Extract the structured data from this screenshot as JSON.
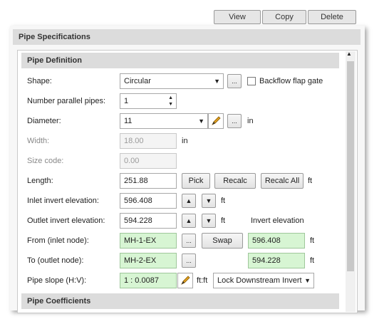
{
  "tabs": {
    "view": "View",
    "copy": "Copy",
    "delete": "Delete"
  },
  "panel_title": "Pipe Specifications",
  "section_definition": "Pipe Definition",
  "section_coefficients": "Pipe Coefficients",
  "labels": {
    "shape": "Shape:",
    "parallel": "Number parallel pipes:",
    "diameter": "Diameter:",
    "width": "Width:",
    "size_code": "Size code:",
    "length": "Length:",
    "inlet_inv": "Inlet invert elevation:",
    "outlet_inv": "Outlet invert elevation:",
    "from": "From (inlet node):",
    "to": "To (outlet node):",
    "slope": "Pipe slope (H:V):",
    "invert_elev_header": "Invert elevation"
  },
  "values": {
    "shape": "Circular",
    "parallel": "1",
    "diameter": "11",
    "width": "18.00",
    "size_code": "0.00",
    "length": "251.88",
    "inlet_inv": "596.408",
    "outlet_inv": "594.228",
    "from_node": "MH-1-EX",
    "to_node": "MH-2-EX",
    "from_inv": "596.408",
    "to_inv": "594.228",
    "slope": "1 : 0.0087",
    "slope_mode": "Lock Downstream Invert"
  },
  "units": {
    "in": "in",
    "ft": "ft",
    "ftft": "ft:ft"
  },
  "buttons": {
    "ellipsis": "...",
    "pick": "Pick",
    "recalc": "Recalc",
    "recalc_all": "Recalc All",
    "swap": "Swap"
  },
  "checkbox": {
    "backflow_label": "Backflow flap gate",
    "backflow_checked": false
  },
  "icons": {
    "up": "▲",
    "down": "▼",
    "dropdown": "▼",
    "spin_up": "▲",
    "spin_down": "▼"
  },
  "colors": {
    "valid_field": "#d7f5d3",
    "header_bg": "#dcdcdc"
  }
}
